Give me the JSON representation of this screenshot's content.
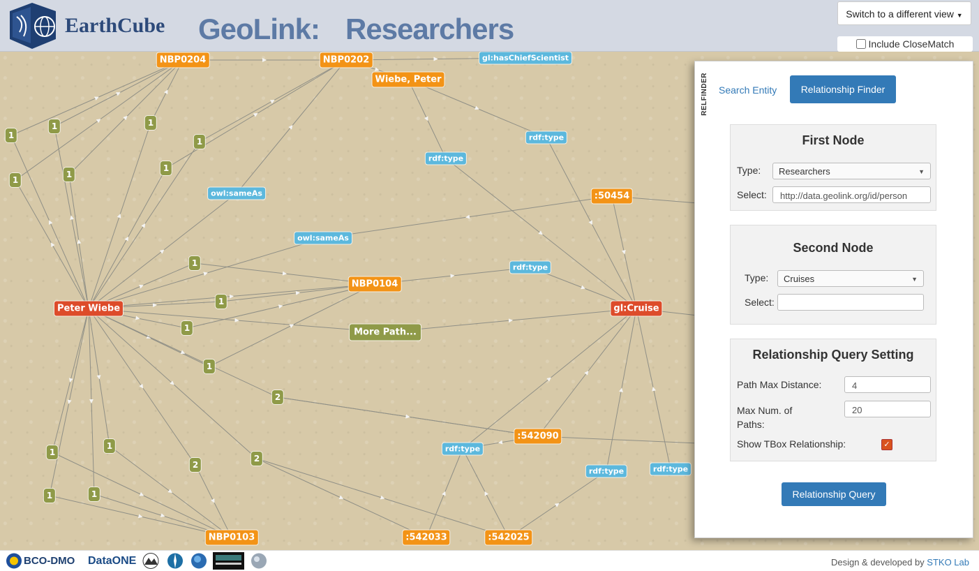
{
  "header": {
    "logo_text": "EarthCube",
    "title": "GeoLink:",
    "subtitle": "Researchers",
    "view_switch_label": "Switch to a different view",
    "closematch_label": "Include CloseMatch"
  },
  "graph": {
    "nodes": [
      {
        "id": "n1",
        "label": "NBP0204",
        "kind": "orange"
      },
      {
        "id": "n2",
        "label": "NBP0202",
        "kind": "orange"
      },
      {
        "id": "n3",
        "label": "gl:hasChiefScientist",
        "kind": "blue"
      },
      {
        "id": "n4",
        "label": "Wiebe, Peter",
        "kind": "orange"
      },
      {
        "id": "n5",
        "label": "rdf:type",
        "kind": "blue"
      },
      {
        "id": "n6",
        "label": "rdf:type",
        "kind": "blue"
      },
      {
        "id": "n7",
        "label": "owl:sameAs",
        "kind": "blue"
      },
      {
        "id": "n8",
        "label": ":50454",
        "kind": "orange"
      },
      {
        "id": "n9",
        "label": "owl:sameAs",
        "kind": "blue"
      },
      {
        "id": "n10",
        "label": "rdf:type",
        "kind": "blue"
      },
      {
        "id": "n11",
        "label": "NBP0104",
        "kind": "orange"
      },
      {
        "id": "n12",
        "label": "Peter Wiebe",
        "kind": "red"
      },
      {
        "id": "n13",
        "label": "gl:Cruise",
        "kind": "red"
      },
      {
        "id": "n14",
        "label": "More Path...",
        "kind": "green-big"
      },
      {
        "id": "n15",
        "label": ":542090",
        "kind": "orange"
      },
      {
        "id": "n16",
        "label": "rdf:type",
        "kind": "blue"
      },
      {
        "id": "n17",
        "label": "rdf:type",
        "kind": "blue"
      },
      {
        "id": "n18",
        "label": "rdf:type",
        "kind": "blue"
      },
      {
        "id": "n19",
        "label": "NBP0103",
        "kind": "orange"
      },
      {
        "id": "n20",
        "label": ":542033",
        "kind": "orange"
      },
      {
        "id": "n21",
        "label": ":542025",
        "kind": "orange"
      },
      {
        "id": "c1",
        "label": "1",
        "kind": "green"
      },
      {
        "id": "c2",
        "label": "1",
        "kind": "green"
      },
      {
        "id": "c3",
        "label": "1",
        "kind": "green"
      },
      {
        "id": "c4",
        "label": "1",
        "kind": "green"
      },
      {
        "id": "c5",
        "label": "1",
        "kind": "green"
      },
      {
        "id": "c6",
        "label": "1",
        "kind": "green"
      },
      {
        "id": "c7",
        "label": "1",
        "kind": "green"
      },
      {
        "id": "c8",
        "label": "1",
        "kind": "green"
      },
      {
        "id": "c9",
        "label": "1",
        "kind": "green"
      },
      {
        "id": "c10",
        "label": "1",
        "kind": "green"
      },
      {
        "id": "c11",
        "label": "1",
        "kind": "green"
      },
      {
        "id": "c12",
        "label": "2",
        "kind": "green"
      },
      {
        "id": "c13",
        "label": "1",
        "kind": "green"
      },
      {
        "id": "c14",
        "label": "1",
        "kind": "green"
      },
      {
        "id": "c15",
        "label": "2",
        "kind": "green"
      },
      {
        "id": "c16",
        "label": "2",
        "kind": "green"
      },
      {
        "id": "c17",
        "label": "1",
        "kind": "green"
      },
      {
        "id": "c18",
        "label": "1",
        "kind": "green"
      }
    ]
  },
  "relfinder": {
    "side_tab": "RELFINDER",
    "tab_search": "Search Entity",
    "tab_relfinder": "Relationship Finder",
    "first_node": {
      "title": "First Node",
      "type_label": "Type:",
      "type_value": "Researchers",
      "select_label": "Select:",
      "select_value": "http://data.geolink.org/id/person"
    },
    "second_node": {
      "title": "Second Node",
      "type_label": "Type:",
      "type_value": "Cruises",
      "select_label": "Select:",
      "select_value": ""
    },
    "query_setting": {
      "title": "Relationship Query Setting",
      "max_distance_label": "Path Max Distance:",
      "max_distance_value": "4",
      "max_paths_label": "Max Num. of Paths:",
      "max_paths_value": "20",
      "tbox_label": "Show TBox Relationship:",
      "tbox_checked": true
    },
    "query_button": "Relationship Query"
  },
  "footer": {
    "credit_prefix": "Design & developed by",
    "credit_link": "STKO Lab",
    "partners": [
      "BCO-DMO",
      "DataONE"
    ]
  }
}
